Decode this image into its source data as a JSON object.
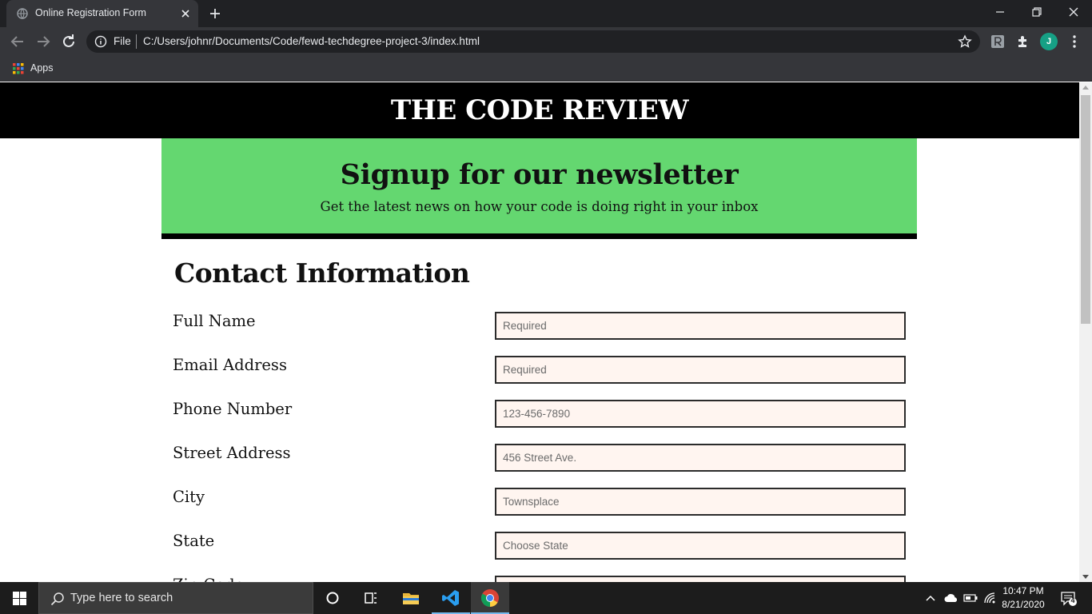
{
  "browser": {
    "tab_title": "Online Registration Form",
    "scheme_label": "File",
    "url": "C:/Users/johnr/Documents/Code/fewd-techdegree-project-3/index.html",
    "profile_initial": "J",
    "bookmarks": [
      {
        "label": "Apps"
      }
    ]
  },
  "page": {
    "site_title": "THE CODE REVIEW",
    "hero": {
      "heading": "Signup for our newsletter",
      "subheading": "Get the latest news on how your code is doing right in your inbox"
    },
    "section_title": "Contact Information",
    "fields": [
      {
        "label": "Full Name",
        "placeholder": "Required"
      },
      {
        "label": "Email Address",
        "placeholder": "Required"
      },
      {
        "label": "Phone Number",
        "placeholder": "123-456-7890"
      },
      {
        "label": "Street Address",
        "placeholder": "456 Street Ave."
      },
      {
        "label": "City",
        "placeholder": "Townsplace"
      },
      {
        "label": "State",
        "placeholder": "Choose State"
      },
      {
        "label": "Zip Code",
        "placeholder": ""
      }
    ]
  },
  "taskbar": {
    "search_placeholder": "Type here to search",
    "time": "10:47 PM",
    "date": "8/21/2020",
    "notification_count": "4"
  },
  "colors": {
    "hero_green": "#64d770",
    "input_bg": "#fff5f0",
    "header_bg": "#000000",
    "chrome_dark": "#202124",
    "chrome_toolbar": "#35363a"
  }
}
